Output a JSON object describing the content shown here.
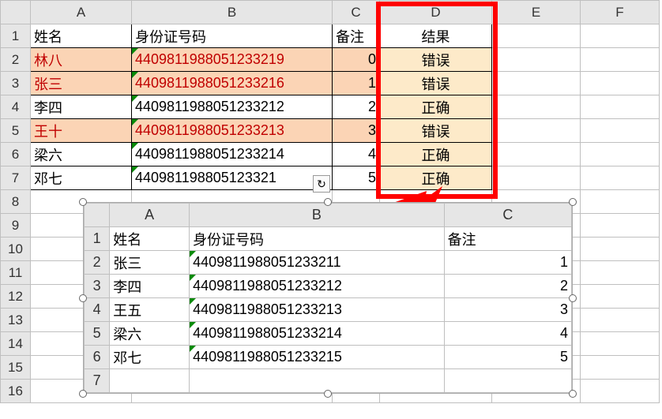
{
  "main": {
    "colHeaders": [
      "A",
      "B",
      "C",
      "D",
      "E",
      "F"
    ],
    "rowHeaders": [
      "1",
      "2",
      "3",
      "4",
      "5",
      "6",
      "7",
      "8",
      "9",
      "10",
      "11",
      "12",
      "13",
      "14",
      "15",
      "16"
    ],
    "header": {
      "name": "姓名",
      "id": "身份证号码",
      "note": "备注",
      "result": "结果"
    },
    "rows": [
      {
        "name": "林八",
        "id": "440981198805123321",
        "note": "0",
        "result": "错误",
        "red": true,
        "peach": true
      },
      {
        "name": "张三",
        "id": "440981198805123321",
        "note": "1",
        "result": "错误",
        "red": true,
        "peach": true
      },
      {
        "name": "李四",
        "id": "440981198805123321",
        "note": "2",
        "result": "正确",
        "red": false,
        "peach": false
      },
      {
        "name": "王十",
        "id": "440981198805123321",
        "note": "3",
        "result": "错误",
        "red": true,
        "peach": true
      },
      {
        "name": "梁六",
        "id": "440981198805123321",
        "note": "4",
        "result": "正确",
        "red": false,
        "peach": false
      },
      {
        "name": "邓七",
        "id": "440981198805123321",
        "note": "5",
        "result": "正确",
        "red": false,
        "peach": false
      }
    ],
    "id_suffix_map": {
      "0": "9",
      "1": "6",
      "2": "2",
      "3": "3",
      "4": "4"
    }
  },
  "embedded": {
    "colHeaders": [
      "A",
      "B",
      "C"
    ],
    "rowHeaders": [
      "1",
      "2",
      "3",
      "4",
      "5",
      "6",
      "7"
    ],
    "header": {
      "name": "姓名",
      "id": "身份证号码",
      "note": "备注"
    },
    "rows": [
      {
        "name": "张三",
        "id": "440981198805123321",
        "note": "1",
        "sfx": "1"
      },
      {
        "name": "李四",
        "id": "440981198805123321",
        "note": "2",
        "sfx": "2"
      },
      {
        "name": "王五",
        "id": "440981198805123321",
        "note": "3",
        "sfx": "3"
      },
      {
        "name": "梁六",
        "id": "440981198805123321",
        "note": "4",
        "sfx": "4"
      },
      {
        "name": "邓七",
        "id": "440981198805123321",
        "note": "5",
        "sfx": "5"
      }
    ]
  }
}
